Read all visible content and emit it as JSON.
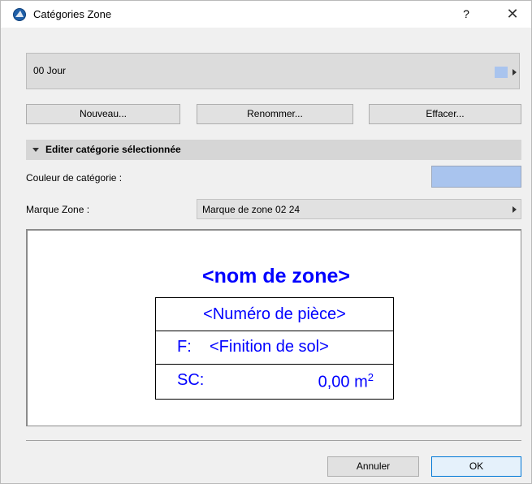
{
  "window": {
    "title": "Catégories Zone",
    "help_label": "?",
    "close_label": "✕"
  },
  "category": {
    "selected_label": "00  Jour",
    "swatch_color": "#a9c4ee"
  },
  "actions": {
    "new_label": "Nouveau...",
    "rename_label": "Renommer...",
    "delete_label": "Effacer..."
  },
  "section": {
    "title": "Editer catégorie sélectionnée"
  },
  "fields": {
    "color_label": "Couleur de catégorie :",
    "color_value": "#a9c4ee",
    "marque_label": "Marque Zone :",
    "marque_value": "Marque de zone 02 24"
  },
  "preview": {
    "zone_name": "<nom de zone>",
    "room_number": "<Numéro de pièce>",
    "finish_prefix": "F:",
    "finish_value": "<Finition de sol>",
    "area_label": "SC:",
    "area_value": "0,00 m",
    "area_unit_exp": "2",
    "text_color": "#0000ff"
  },
  "footer": {
    "cancel_label": "Annuler",
    "ok_label": "OK"
  }
}
